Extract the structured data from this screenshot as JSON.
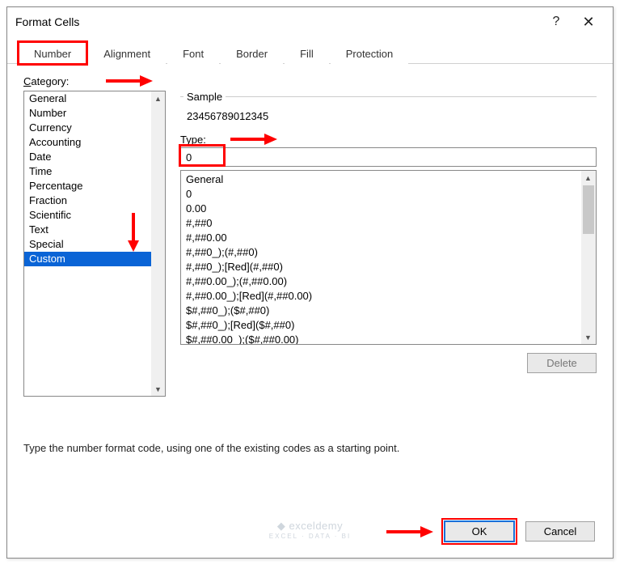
{
  "window": {
    "title": "Format Cells",
    "help": "?",
    "close": "✕"
  },
  "tabs": {
    "items": [
      "Number",
      "Alignment",
      "Font",
      "Border",
      "Fill",
      "Protection"
    ],
    "active_index": 0
  },
  "category": {
    "label_pre": "C",
    "label_post": "ategory:",
    "items": [
      "General",
      "Number",
      "Currency",
      "Accounting",
      "Date",
      "Time",
      "Percentage",
      "Fraction",
      "Scientific",
      "Text",
      "Special",
      "Custom"
    ],
    "selected_index": 11
  },
  "sample": {
    "label": "Sample",
    "value": "23456789012345"
  },
  "type": {
    "label_pre": "T",
    "label_post": "ype:",
    "value": "0"
  },
  "format_list": {
    "items": [
      "General",
      "0",
      "0.00",
      "#,##0",
      "#,##0.00",
      "#,##0_);(#,##0)",
      "#,##0_);[Red](#,##0)",
      "#,##0.00_);(#,##0.00)",
      "#,##0.00_);[Red](#,##0.00)",
      "$#,##0_);($#,##0)",
      "$#,##0_);[Red]($#,##0)",
      "$#,##0.00_);($#,##0.00)"
    ]
  },
  "buttons": {
    "delete": "Delete",
    "ok": "OK",
    "cancel": "Cancel"
  },
  "hint": "Type the number format code, using one of the existing codes as a starting point.",
  "watermark": {
    "brand": "exceldemy",
    "sub": "EXCEL · DATA · BI"
  },
  "chart_data": null
}
